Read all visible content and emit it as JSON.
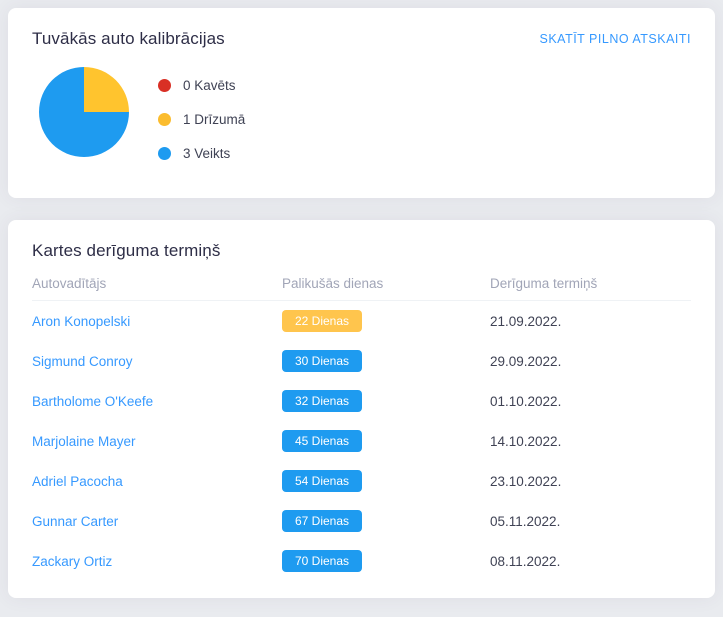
{
  "calibrations": {
    "title": "Tuvākās auto kalibrācijas",
    "report_link": "SKATĪT PILNO ATSKAITI",
    "legend": [
      {
        "label": "0 Kavēts",
        "color": "#d93025",
        "value": 0,
        "name": "Kavēts"
      },
      {
        "label": "1 Drīzumā",
        "color": "#fbbc2e",
        "value": 1,
        "name": "Drīzumā"
      },
      {
        "label": "3 Veikts",
        "color": "#1e9bf0",
        "value": 3,
        "name": "Veikts"
      }
    ]
  },
  "chart_data": {
    "type": "pie",
    "title": "Tuvākās auto kalibrācijas",
    "categories": [
      "Kavēts",
      "Drīzumā",
      "Veikts"
    ],
    "values": [
      0,
      1,
      3
    ],
    "colors": [
      "#d93025",
      "#fbbc2e",
      "#1e9bf0"
    ],
    "labels": [
      "0 Kavēts",
      "1 Drīzumā",
      "3 Veikts"
    ],
    "legend_position": "right",
    "start_angle": 0,
    "total": 4
  },
  "expiry": {
    "title": "Kartes derīguma termiņš",
    "columns": {
      "driver": "Autovadītājs",
      "days": "Palikušās dienas",
      "expiry": "Derīguma termiņš"
    },
    "rows": [
      {
        "driver": "Aron Konopelski",
        "days": "22 Dienas",
        "badge": "warning",
        "expiry": "21.09.2022."
      },
      {
        "driver": "Sigmund Conroy",
        "days": "30 Dienas",
        "badge": "primary",
        "expiry": "29.09.2022."
      },
      {
        "driver": "Bartholome O'Keefe",
        "days": "32 Dienas",
        "badge": "primary",
        "expiry": "01.10.2022."
      },
      {
        "driver": "Marjolaine Mayer",
        "days": "45 Dienas",
        "badge": "primary",
        "expiry": "14.10.2022."
      },
      {
        "driver": "Adriel Pacocha",
        "days": "54 Dienas",
        "badge": "primary",
        "expiry": "23.10.2022."
      },
      {
        "driver": "Gunnar Carter",
        "days": "67 Dienas",
        "badge": "primary",
        "expiry": "05.11.2022."
      },
      {
        "driver": "Zackary Ortiz",
        "days": "70 Dienas",
        "badge": "primary",
        "expiry": "08.11.2022."
      }
    ]
  },
  "colors": {
    "page_background": "#e9ebef",
    "card_background": "#ffffff",
    "link": "#3699ff",
    "title": "#2e2e47",
    "muted": "#a1a5b7",
    "text": "#3f4254",
    "warning": "#ffc54d",
    "primary": "#1e9bf0",
    "danger": "#d93025"
  }
}
